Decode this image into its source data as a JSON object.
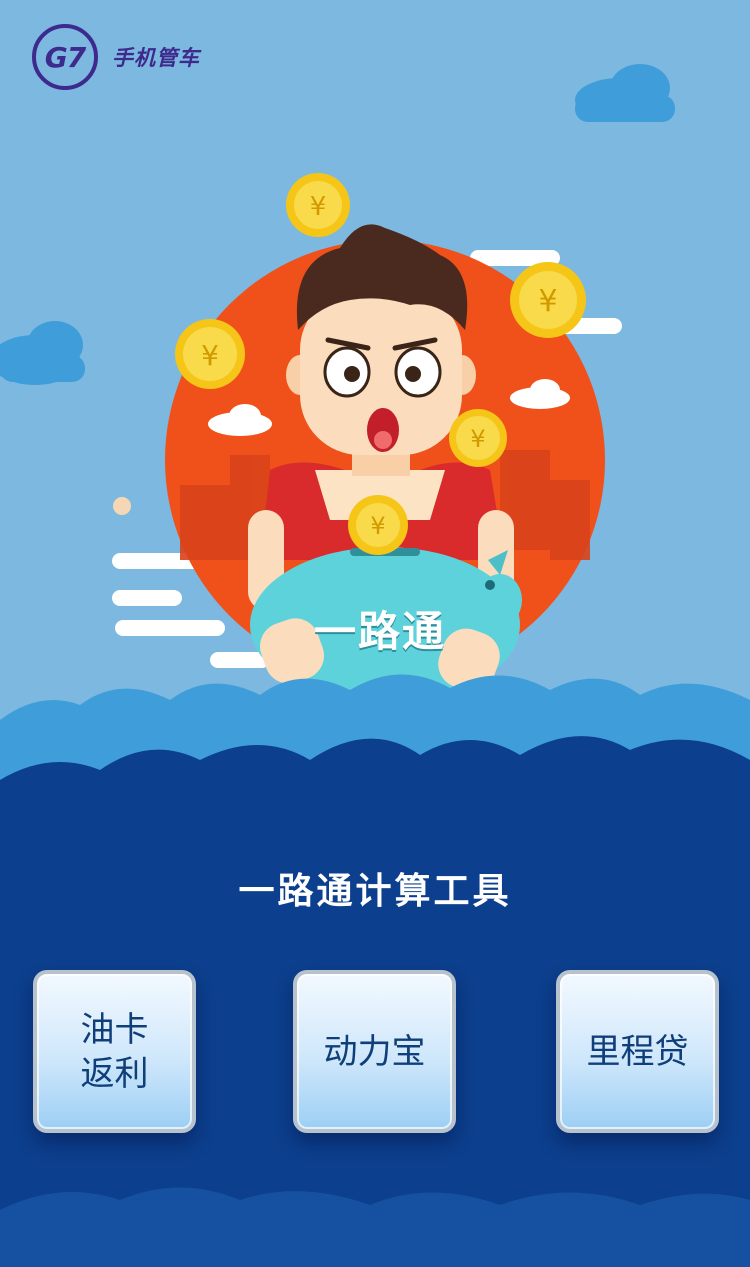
{
  "brand": {
    "logo_text": "G7",
    "name": "手机管车"
  },
  "hero": {
    "piggy_label": "一路通",
    "coin_symbol": "¥"
  },
  "section": {
    "title": "一路通计算工具"
  },
  "tools": [
    {
      "label": "油卡返利"
    },
    {
      "label": "动力宝"
    },
    {
      "label": "里程贷"
    }
  ],
  "colors": {
    "sky": "#7cb8e0",
    "brand": "#3d2a8c",
    "sun_circle": "#f0501a",
    "coin": "#f5c518",
    "piggy": "#5ed2db",
    "deep_blue": "#0c3f8d",
    "card_text": "#0f3f7a"
  }
}
